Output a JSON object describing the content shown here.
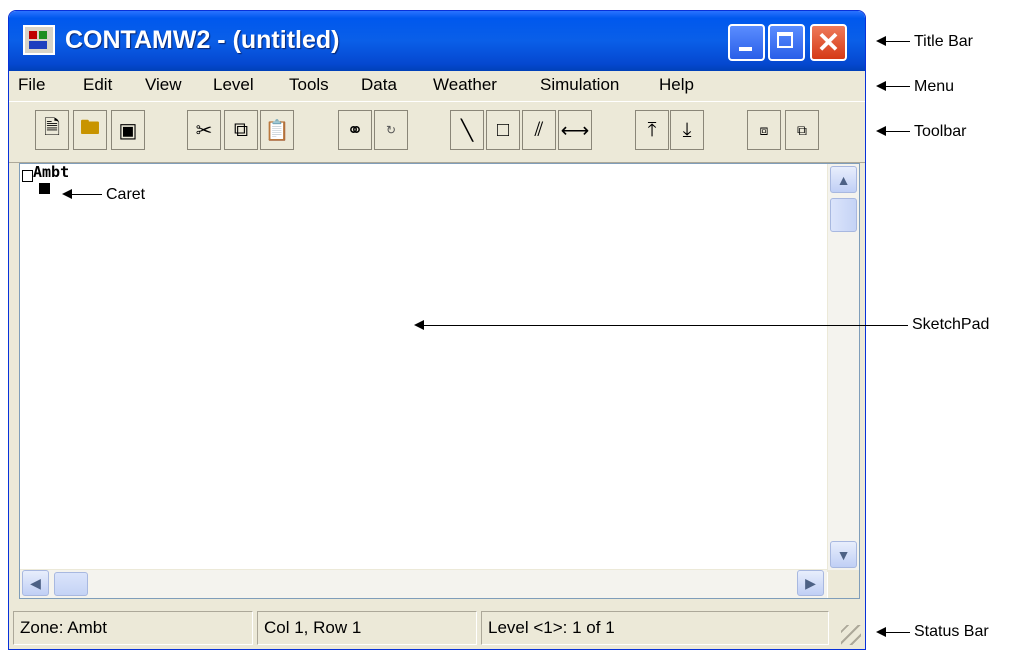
{
  "window": {
    "title": "CONTAMW2 - (untitled)"
  },
  "menu": {
    "items": [
      "File",
      "Edit",
      "View",
      "Level",
      "Tools",
      "Data",
      "Weather",
      "Simulation",
      "Help"
    ]
  },
  "toolbar": {
    "icons": [
      "new-file-icon",
      "open-folder-icon",
      "save-disk-icon",
      "cut-scissors-icon",
      "copy-icon",
      "paste-icon",
      "find-binoculars-icon",
      "swap-ab-icon",
      "wall-line-icon",
      "rectangle-icon",
      "double-line-icon",
      "bidirectional-arrow-icon",
      "level-up-icon",
      "level-down-icon",
      "paste-level-icon",
      "copy-level-icon"
    ]
  },
  "sketchpad": {
    "zone_label": "Ambt"
  },
  "status": {
    "zone": "Zone: Ambt",
    "position": "Col 1, Row 1",
    "level": "Level <1>: 1 of 1"
  },
  "annotations": {
    "title_bar": "Title Bar",
    "menu": "Menu",
    "toolbar": "Toolbar",
    "caret": "Caret",
    "sketchpad": "SketchPad",
    "status_bar": "Status Bar"
  }
}
